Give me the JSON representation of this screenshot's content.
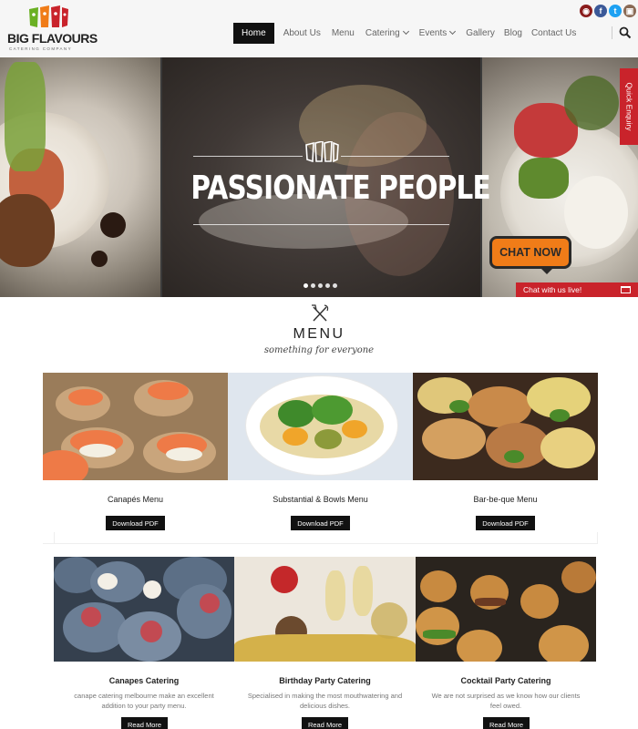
{
  "brand": {
    "name": "BIG FLAVOURS",
    "tagline": "CATERING COMPANY",
    "colors": {
      "red": "#c9232b",
      "orange": "#f07c18",
      "green": "#6ab023",
      "dark": "#111111"
    }
  },
  "social": [
    {
      "icon": "tripadvisor-icon",
      "glyph": "◉",
      "color": "#8a1c1c"
    },
    {
      "icon": "facebook-icon",
      "glyph": "f",
      "color": "#3b5998"
    },
    {
      "icon": "twitter-icon",
      "glyph": "t",
      "color": "#1da1f2"
    },
    {
      "icon": "instagram-icon",
      "glyph": "▣",
      "color": "#8a6a55"
    }
  ],
  "nav": {
    "items": [
      {
        "label": "Home",
        "active": true,
        "dropdown": false
      },
      {
        "label": "About Us",
        "active": false,
        "dropdown": false
      },
      {
        "label": "Menu",
        "active": false,
        "dropdown": false
      },
      {
        "label": "Catering",
        "active": false,
        "dropdown": true
      },
      {
        "label": "Events",
        "active": false,
        "dropdown": true
      },
      {
        "label": "Gallery",
        "active": false,
        "dropdown": false
      },
      {
        "label": "Blog",
        "active": false,
        "dropdown": false
      },
      {
        "label": "Contact Us",
        "active": false,
        "dropdown": false
      }
    ],
    "search_icon": "search-icon"
  },
  "hero": {
    "title": "PASSIONATE PEOPLE",
    "slide_count": 5,
    "active_slide": 1
  },
  "quick_enquiry": {
    "label": "Quick Enquiry"
  },
  "chat": {
    "bubble_label": "CHAT NOW",
    "bar_label": "Chat with us live!"
  },
  "menu_section": {
    "title": "MENU",
    "subtitle": "something for everyone",
    "icon": "fork-knife-icon"
  },
  "menus": [
    {
      "title": "Canapés Menu",
      "button": "Download PDF"
    },
    {
      "title": "Substantial & Bowls Menu",
      "button": "Download PDF"
    },
    {
      "title": "Bar-be-que Menu",
      "button": "Download PDF"
    }
  ],
  "catering": [
    {
      "title": "Canapes Catering",
      "description": "canape catering melbourne make an excellent addition to your party menu.",
      "button": "Read More"
    },
    {
      "title": "Birthday Party Catering",
      "description": "Specialised in making the most mouthwatering and delicious dishes.",
      "button": "Read More"
    },
    {
      "title": "Cocktail Party Catering",
      "description": "We are not surprised as we know how our clients feel owed.",
      "button": "Read More"
    }
  ]
}
